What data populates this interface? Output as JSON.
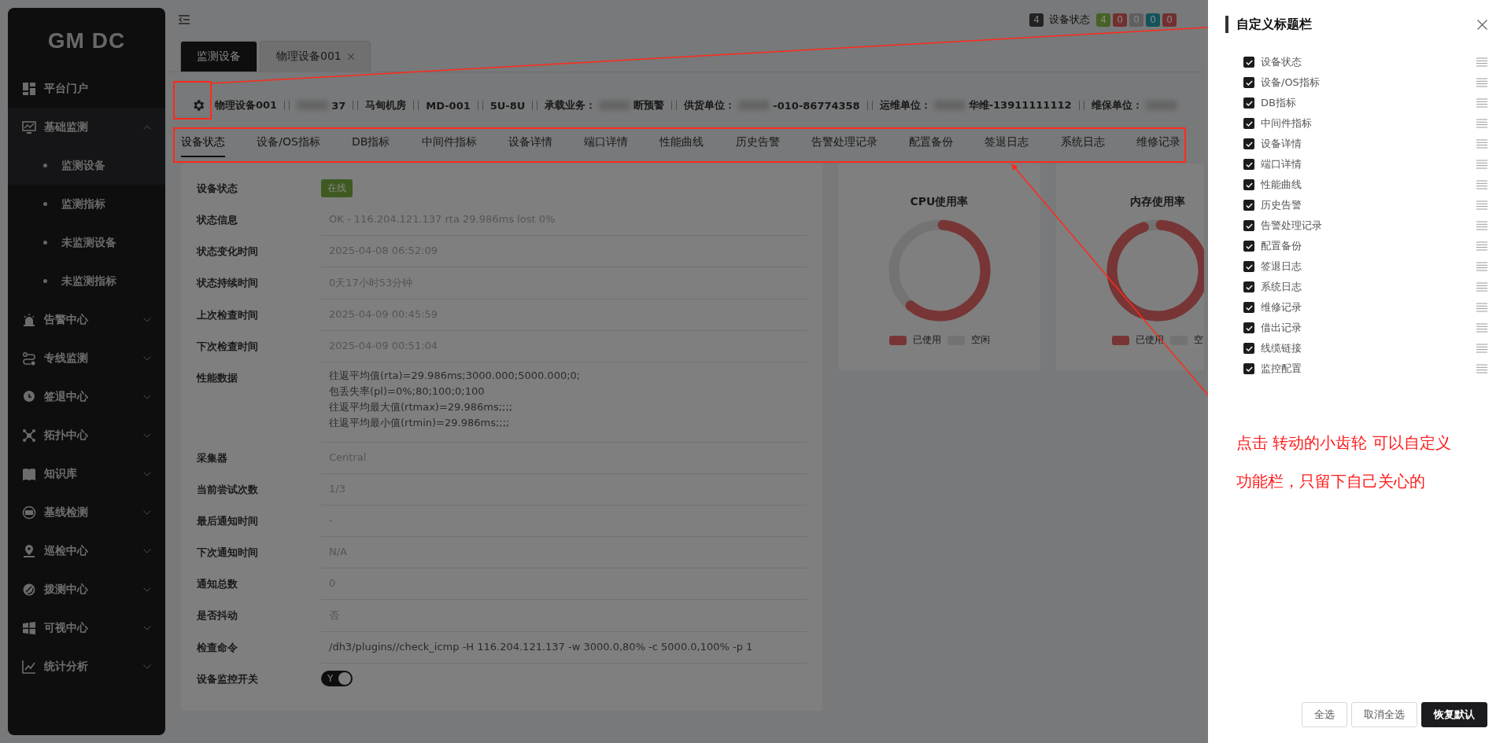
{
  "sidebar": {
    "logo": "GM DC",
    "items": [
      {
        "kind": "link",
        "label": "平台门户"
      },
      {
        "kind": "group",
        "label": "基础监测",
        "expanded": true,
        "children": [
          {
            "label": "监测设备",
            "selected": true
          },
          {
            "label": "监测指标",
            "selected": false
          },
          {
            "label": "未监测设备",
            "selected": false
          },
          {
            "label": "未监测指标",
            "selected": false
          }
        ]
      },
      {
        "kind": "group",
        "label": "告警中心",
        "expanded": false
      },
      {
        "kind": "group",
        "label": "专线监测",
        "expanded": false
      },
      {
        "kind": "group",
        "label": "签退中心",
        "expanded": false
      },
      {
        "kind": "group",
        "label": "拓扑中心",
        "expanded": false
      },
      {
        "kind": "group",
        "label": "知识库",
        "expanded": false
      },
      {
        "kind": "group",
        "label": "基线检测",
        "expanded": false
      },
      {
        "kind": "group",
        "label": "巡检中心",
        "expanded": false
      },
      {
        "kind": "group",
        "label": "拨测中心",
        "expanded": false
      },
      {
        "kind": "group",
        "label": "可视中心",
        "expanded": false
      },
      {
        "kind": "group",
        "label": "统计分析",
        "expanded": false
      }
    ]
  },
  "status": {
    "total": "4",
    "label": "设备状态",
    "counts": [
      {
        "value": "4",
        "color": "#466225"
      },
      {
        "value": "0",
        "color": "#722f2f"
      },
      {
        "value": "0",
        "color": "#5f5f5f"
      },
      {
        "value": "0",
        "color": "#13535b"
      },
      {
        "value": "0",
        "color": "#722f2f"
      }
    ]
  },
  "page_tabs": [
    {
      "label": "监测设备",
      "selected": true,
      "closable": false
    },
    {
      "label": "物理设备001",
      "selected": false,
      "closable": true
    }
  ],
  "device_info": [
    {
      "value": "物理设备001"
    },
    {
      "masked": true,
      "value": "37"
    },
    {
      "value": "马甸机房"
    },
    {
      "value": "MD-001"
    },
    {
      "value": "5U-8U"
    },
    {
      "label": "承载业务：",
      "masked": true,
      "value": "断预警"
    },
    {
      "label": "供货单位：",
      "masked": true,
      "value": "-010-86774358"
    },
    {
      "label": "运维单位：",
      "masked": true,
      "value": "华维-13911111112"
    },
    {
      "label": "维保单位：",
      "masked": true
    }
  ],
  "detail_tabs": [
    {
      "label": "设备状态",
      "selected": true
    },
    {
      "label": "设备/OS指标",
      "selected": false
    },
    {
      "label": "DB指标",
      "selected": false
    },
    {
      "label": "中间件指标",
      "selected": false
    },
    {
      "label": "设备详情",
      "selected": false
    },
    {
      "label": "端口详情",
      "selected": false
    },
    {
      "label": "性能曲线",
      "selected": false
    },
    {
      "label": "历史告警",
      "selected": false
    },
    {
      "label": "告警处理记录",
      "selected": false
    },
    {
      "label": "配置备份",
      "selected": false
    },
    {
      "label": "签退日志",
      "selected": false
    },
    {
      "label": "系统日志",
      "selected": false
    },
    {
      "label": "维修记录",
      "selected": false
    }
  ],
  "status_form": [
    {
      "kind": "tag",
      "label": "设备状态",
      "value": "在线",
      "color": "#3e5a21"
    },
    {
      "kind": "text",
      "label": "状态信息",
      "value": "OK - 116.204.121.137 rta 29.986ms lost 0%"
    },
    {
      "kind": "text",
      "label": "状态变化时间",
      "value": "2025-04-08 06:52:09"
    },
    {
      "kind": "text",
      "label": "状态持续时间",
      "value": "0天17小时53分钟"
    },
    {
      "kind": "text",
      "label": "上次检查时间",
      "value": "2025-04-09 00:45:59"
    },
    {
      "kind": "text",
      "label": "下次检查时间",
      "value": "2025-04-09 00:51:04"
    },
    {
      "kind": "textarea",
      "label": "性能数据",
      "value": "往返平均值(rta)=29.986ms;3000.000;5000.000;0;\n包丢失率(pl)=0%;80;100;0;100\n往返平均最大值(rtmax)=29.986ms;;;;\n往返平均最小值(rtmin)=29.986ms;;;;"
    },
    {
      "kind": "text",
      "label": "采集器",
      "value": "Central"
    },
    {
      "kind": "text",
      "label": "当前尝试次数",
      "value": "1/3"
    },
    {
      "kind": "text",
      "label": "最后通知时间",
      "value": "-"
    },
    {
      "kind": "text",
      "label": "下次通知时间",
      "value": "N/A"
    },
    {
      "kind": "text",
      "label": "通知总数",
      "value": "0"
    },
    {
      "kind": "text",
      "label": "是否抖动",
      "value": "否"
    },
    {
      "kind": "command",
      "label": "检查命令",
      "value": "/dh3/plugins//check_icmp -H 116.204.121.137 -w 3000.0,80% -c 5000.0,100% -p 1"
    },
    {
      "kind": "toggle",
      "label": "设备监控开关",
      "value": "Y",
      "on": true
    }
  ],
  "charts": [
    {
      "title": "CPU使用率",
      "legend": [
        "已使用",
        "空闲"
      ]
    },
    {
      "title": "内存使用率",
      "legend": [
        "已使用",
        "空"
      ]
    }
  ],
  "drawer": {
    "title": "自定义标题栏",
    "items": [
      {
        "label": "设备状态",
        "checked": true
      },
      {
        "label": "设备/OS指标",
        "checked": true
      },
      {
        "label": "DB指标",
        "checked": true
      },
      {
        "label": "中间件指标",
        "checked": true
      },
      {
        "label": "设备详情",
        "checked": true
      },
      {
        "label": "端口详情",
        "checked": true
      },
      {
        "label": "性能曲线",
        "checked": true
      },
      {
        "label": "历史告警",
        "checked": true
      },
      {
        "label": "告警处理记录",
        "checked": true
      },
      {
        "label": "配置备份",
        "checked": true
      },
      {
        "label": "签退日志",
        "checked": true
      },
      {
        "label": "系统日志",
        "checked": true
      },
      {
        "label": "维修记录",
        "checked": true
      },
      {
        "label": "借出记录",
        "checked": true
      },
      {
        "label": "线缆链接",
        "checked": true
      },
      {
        "label": "监控配置",
        "checked": true
      }
    ],
    "buttons": [
      {
        "label": "全选",
        "primary": false
      },
      {
        "label": "取消全选",
        "primary": false
      },
      {
        "label": "恢复默认",
        "primary": true
      }
    ]
  },
  "annotation": {
    "lines": [
      "点击 转动的小齿轮  可以自定义",
      "功能栏，只留下自己关心的"
    ]
  }
}
